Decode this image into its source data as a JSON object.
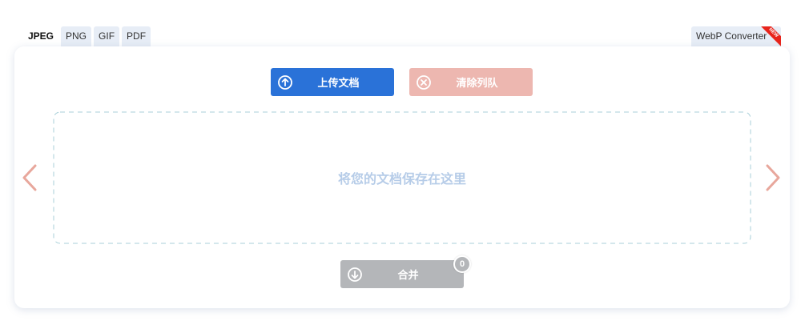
{
  "tabs": [
    {
      "label": "JPEG",
      "active": true
    },
    {
      "label": "PNG",
      "active": false
    },
    {
      "label": "GIF",
      "active": false
    },
    {
      "label": "PDF",
      "active": false
    }
  ],
  "webp_tab": {
    "label": "WebP Converter",
    "ribbon": "NEW"
  },
  "toolbar": {
    "upload_label": "上传文档",
    "clear_label": "清除列队"
  },
  "dropzone": {
    "text": "将您的文档保存在这里"
  },
  "merge": {
    "label": "合并",
    "count": "0"
  },
  "colors": {
    "upload": "#2a72d8",
    "clear": "#edb7b0",
    "merge": "#b4b6b9",
    "arrow": "#e8a79c",
    "ribbon": "#e8241b"
  },
  "icons": {
    "upload": "arrow-up-circle-icon",
    "clear": "x-circle-icon",
    "merge": "arrow-down-circle-icon",
    "prev": "chevron-left-icon",
    "next": "chevron-right-icon"
  }
}
